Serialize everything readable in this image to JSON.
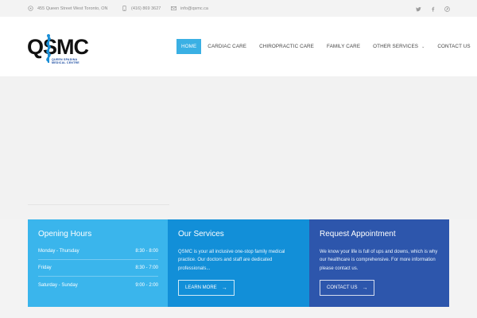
{
  "topbar": {
    "address": "455 Queen Street West Toronto, ON",
    "phone": "(416) 869 3627",
    "email": "info@qsmc.ca",
    "icons": [
      "map-pin-icon",
      "phone-icon",
      "mail-icon"
    ],
    "social": [
      "twitter-icon",
      "facebook-icon",
      "pinterest-icon"
    ]
  },
  "logo": {
    "text": "QSMC",
    "sub_line1": "QUEEN SPADINA",
    "sub_line2": "MEDICAL CENTRE"
  },
  "nav": {
    "items": [
      {
        "label": "HOME",
        "active": true
      },
      {
        "label": "CARDIAC CARE"
      },
      {
        "label": "CHIROPRACTIC CARE"
      },
      {
        "label": "FAMILY CARE"
      },
      {
        "label": "OTHER SERVICES",
        "dropdown": true
      },
      {
        "label": "CONTACT US"
      }
    ]
  },
  "boxes": {
    "hours": {
      "title": "Opening Hours",
      "rows": [
        {
          "day": "Monday - Thursday",
          "time": "8:30 - 8:00"
        },
        {
          "day": "Friday",
          "time": "8:30 - 7:00"
        },
        {
          "day": "Saturday - Sunday",
          "time": "9:00 - 2:00"
        }
      ]
    },
    "services": {
      "title": "Our Services",
      "text": "QSMC is your all inclusive one-stop family medical practice. Our doctors and staff are dedicated professionals...",
      "button": "LEARN MORE"
    },
    "appointment": {
      "title": "Request Appointment",
      "text": "We know your life is full of ups and downs, which is why our healthcare is comprehensive. For more information please contact us.",
      "button": "CONTACT US"
    }
  },
  "colors": {
    "accent": "#3ab0e4",
    "hours_bg": "#3ab5ec",
    "services_bg": "#128fd8",
    "appointment_bg": "#2d56ac"
  }
}
